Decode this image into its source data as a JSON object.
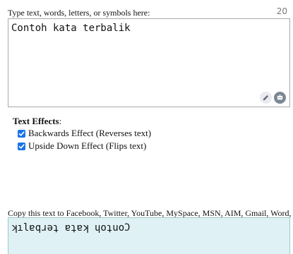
{
  "input": {
    "label": "Type text, words, letters, or symbols here:",
    "char_count": "20",
    "value": "Contoh kata terbalik"
  },
  "icons": {
    "pencil": "pencil-icon",
    "assistant": "assistant-icon"
  },
  "effects": {
    "title": "Text Effects",
    "title_suffix": ":",
    "options": [
      {
        "label": "Backwards Effect (Reverses text)",
        "checked": true
      },
      {
        "label": "Upside Down Effect (Flips text)",
        "checked": true
      }
    ]
  },
  "output": {
    "label": "Copy this text to Facebook, Twitter, YouTube, MySpace, MSN, AIM, Gmail, Word, etc:",
    "value": "ʞılɐqɹǝʇ ɐʇɐʞ ɥoʇuoƆ"
  },
  "colors": {
    "checkbox": "#1a73e8",
    "output_bg": "#dff1f4",
    "input_border": "#a9a9a9"
  }
}
